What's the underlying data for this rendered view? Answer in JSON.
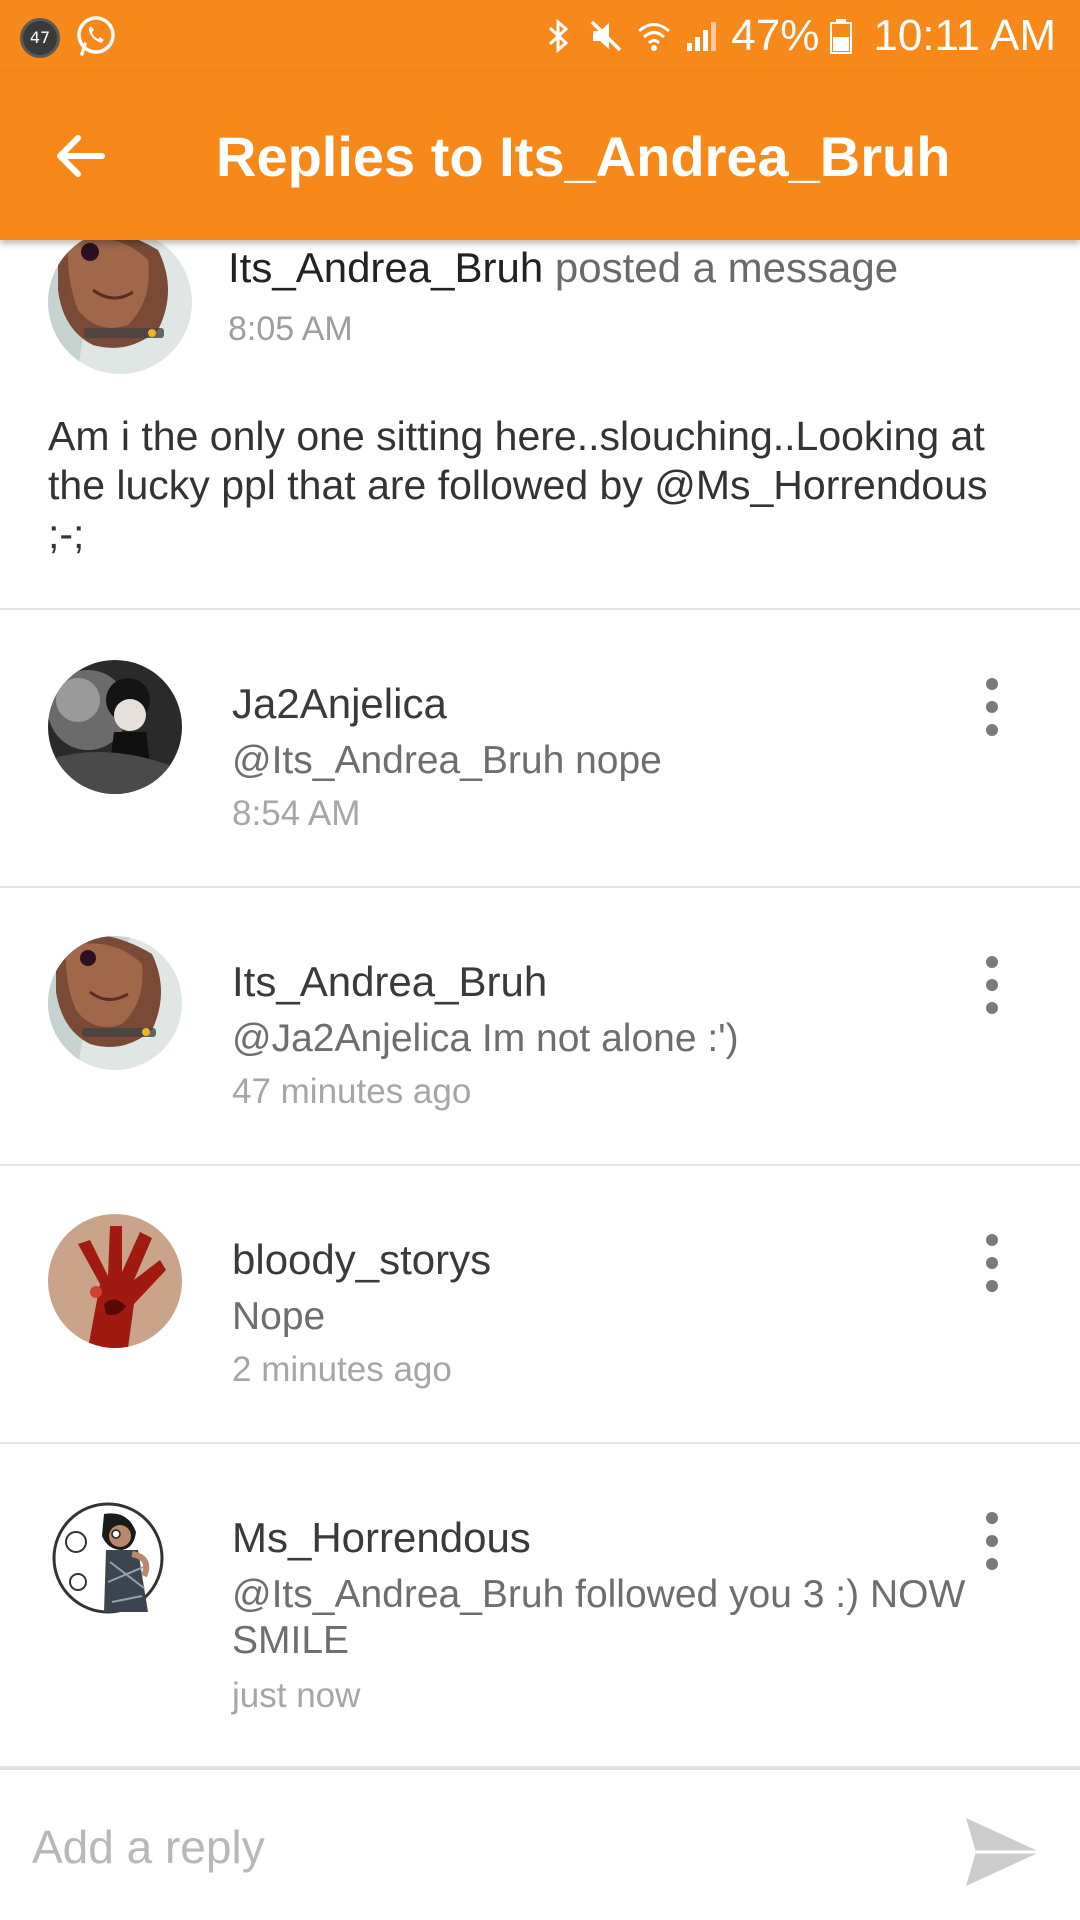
{
  "status_bar": {
    "notification_count": "47",
    "battery_percent": "47%",
    "time": "10:11 AM",
    "icons": [
      "whatsapp-icon",
      "bluetooth-icon",
      "mute-icon",
      "wifi-icon",
      "signal-icon",
      "battery-icon"
    ]
  },
  "app_bar": {
    "title": "Replies to Its_Andrea_Bruh",
    "back_icon": "arrow-left-icon"
  },
  "post": {
    "author": "Its_Andrea_Bruh",
    "action": " posted a message",
    "time": "8:05 AM",
    "body": "Am i the only one sitting here..slouching..Looking at the lucky ppl that are followed by @Ms_Horrendous ;-;"
  },
  "replies": [
    {
      "name": "Ja2Anjelica",
      "text": "@Its_Andrea_Bruh nope",
      "time": "8:54 AM"
    },
    {
      "name": "Its_Andrea_Bruh",
      "text": "@Ja2Anjelica Im not alone :')",
      "time": "47 minutes ago"
    },
    {
      "name": "bloody_storys",
      "text": "Nope",
      "time": "2 minutes ago"
    },
    {
      "name": "Ms_Horrendous",
      "text": "@Its_Andrea_Bruh followed you 3 :) NOW SMILE",
      "time": "just now"
    }
  ],
  "composer": {
    "placeholder": "Add a reply",
    "send_icon": "send-icon"
  },
  "colors": {
    "accent": "#f7891a",
    "divider": "#e6e6e6"
  }
}
